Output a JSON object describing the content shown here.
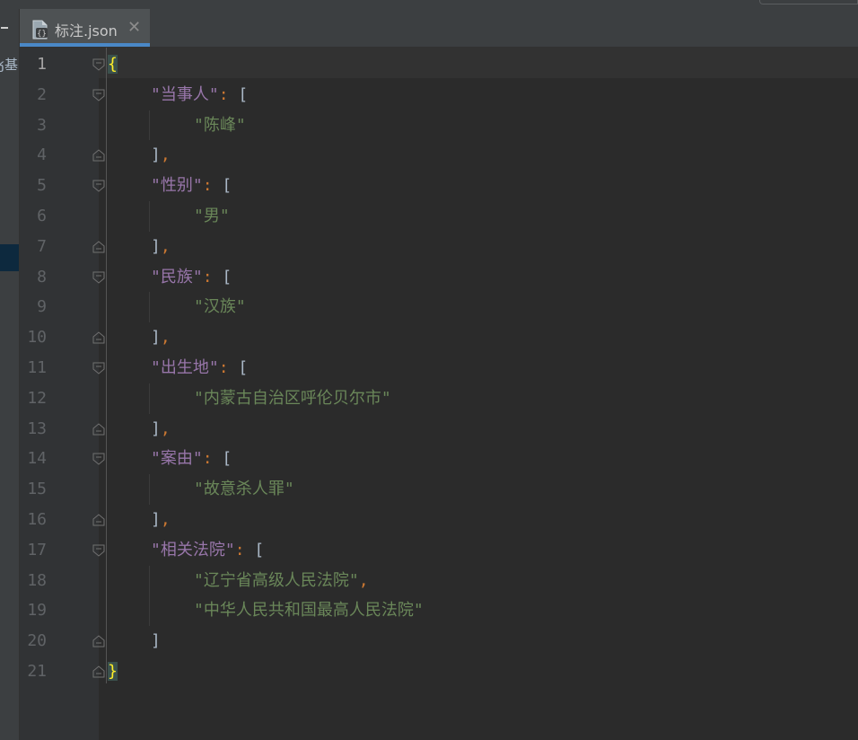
{
  "tab": {
    "label": "标注.json",
    "close_glyph": "✕",
    "icon": "json-file-icon"
  },
  "left_panel": {
    "clipped_text": "ӄ基"
  },
  "editor": {
    "line_numbers": [
      "1",
      "2",
      "3",
      "4",
      "5",
      "6",
      "7",
      "8",
      "9",
      "10",
      "11",
      "12",
      "13",
      "14",
      "15",
      "16",
      "17",
      "18",
      "19",
      "20",
      "21"
    ],
    "open_brace": "{",
    "close_brace": "}",
    "fields": [
      {
        "key": "\"当事人\"",
        "values": [
          "\"陈峰\""
        ]
      },
      {
        "key": "\"性别\"",
        "values": [
          "\"男\""
        ]
      },
      {
        "key": "\"民族\"",
        "values": [
          "\"汉族\""
        ]
      },
      {
        "key": "\"出生地\"",
        "values": [
          "\"内蒙古自治区呼伦贝尔市\""
        ]
      },
      {
        "key": "\"案由\"",
        "values": [
          "\"故意杀人罪\""
        ]
      },
      {
        "key": "\"相关法院\"",
        "values": [
          "\"辽宁省高级人民法院\"",
          "\"中华人民共和国最高人民法院\""
        ]
      }
    ],
    "colon": ":",
    "open_bracket": "[",
    "close_bracket": "]",
    "comma": ","
  },
  "colors": {
    "key": "#9876aa",
    "string": "#6a8759",
    "punct": "#cc7832",
    "bracket": "#a9b7c6",
    "brace_match": "#ffef28",
    "tab_underline": "#4a88c7"
  }
}
